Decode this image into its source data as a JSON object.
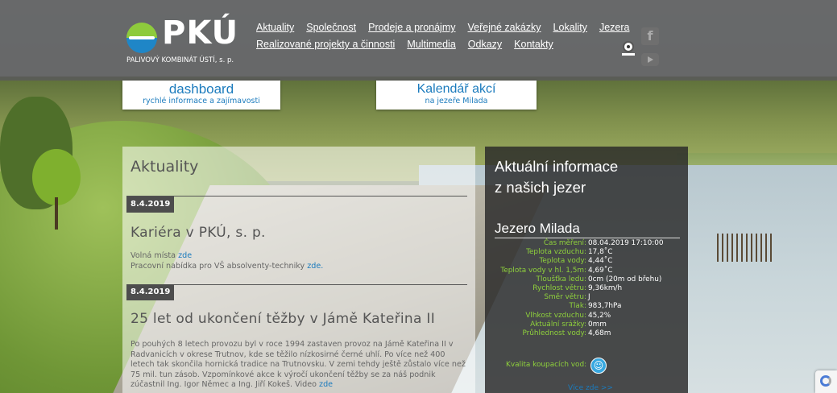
{
  "brand": {
    "name": "PKÚ",
    "subtitle": "PALIVOVÝ KOMBINÁT ÚSTÍ, s. p."
  },
  "nav": {
    "row1": [
      "Aktuality",
      "Společnost",
      "Prodeje a pronájmy",
      "Veřejné zakázky",
      "Lokality",
      "Jezera"
    ],
    "row2": [
      "Realizované projekty a činnosti",
      "Multimedia",
      "Odkazy",
      "Kontakty"
    ]
  },
  "social": {
    "icons": [
      "facebook-icon",
      "youtube-icon",
      "webcam-icon"
    ]
  },
  "tabs": [
    {
      "title": "dashboard",
      "subtitle": "rychlé informace a zajímavosti"
    },
    {
      "title": "Kalendář akcí",
      "subtitle": "na jezeře Milada"
    }
  ],
  "news": {
    "heading": "Aktuality",
    "items": [
      {
        "date": "8.4.2019",
        "title": "Kariéra v PKÚ, s. p.",
        "line1_text": "Volná místa ",
        "line1_link": "zde",
        "line2_text": "Pracovní nabídka pro VŠ absolventy-techniky ",
        "line2_link": "zde."
      },
      {
        "date": "8.4.2019",
        "title": "25 let od ukončení těžby v Jámě Kateřina II",
        "body": "Po pouhých 8 letech provozu byl v roce 1994 zastaven provoz na Jámě Kateřina II v Radvanicích v okrese Trutnov, kde se těžilo nízkosirné černé uhlí. Po více než 400 letech tak skončila hornická tradice na Trutnovsku. V zemi tehdy ještě zůstalo více než 75 mil. tun zásob. Vzpomínkové akce k výročí ukončení těžby se za náš podnik zúčastnil Ing. Igor Němec a Ing. Jiří Kokeš. Video ",
        "body_link": "zde"
      }
    ]
  },
  "info": {
    "heading_line1": "Aktuální informace",
    "heading_line2": "z našich jezer",
    "lake": "Jezero Milada",
    "rows": [
      {
        "k": "Čas měření:",
        "v": "08.04.2019 17:10:00"
      },
      {
        "k": "Teplota vzduchu:",
        "v": "17,8˚C"
      },
      {
        "k": "Teplota vody:",
        "v": "4,44˚C"
      },
      {
        "k": "Teplota vody v hl. 1,5m:",
        "v": "4,69˚C"
      },
      {
        "k": "Tloušťka ledu:",
        "v": "0cm (20m od břehu)"
      },
      {
        "k": "Rychlost větru:",
        "v": "9,36km/h"
      },
      {
        "k": "Směr větru:",
        "v": "J"
      },
      {
        "k": "Tlak:",
        "v": "983,7hPa"
      },
      {
        "k": "Vlhkost vzduchu:",
        "v": "45,2%"
      },
      {
        "k": "Aktuální srážky:",
        "v": "0mm"
      },
      {
        "k": "Průhlednost vody:",
        "v": "4,68m"
      }
    ],
    "quality_label": "Kvalita koupacích vod:",
    "quality_icon": "smiley-icon",
    "more": "Více zde >>"
  }
}
